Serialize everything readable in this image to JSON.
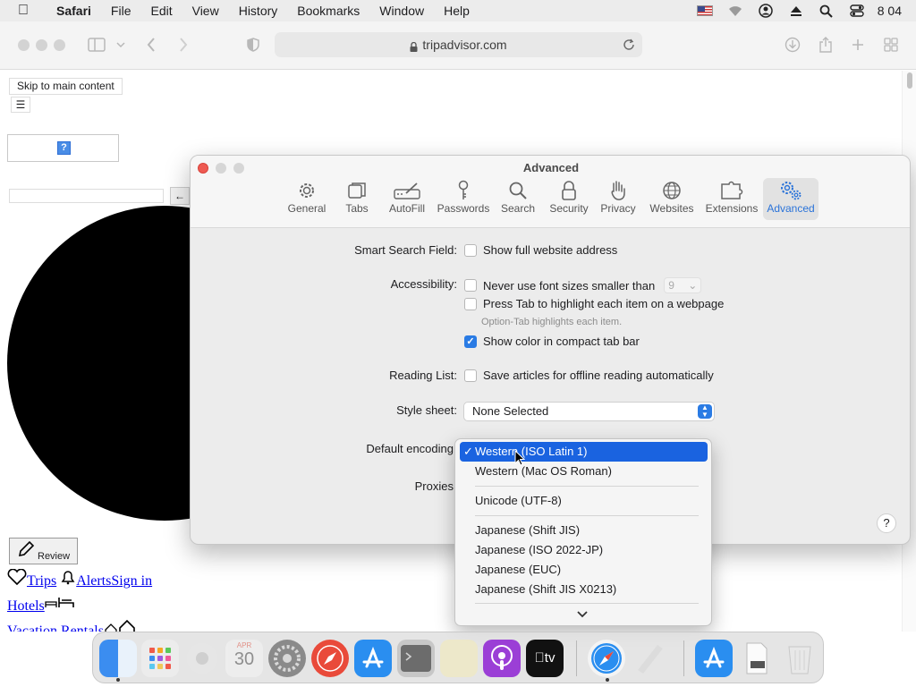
{
  "menubar": {
    "app": "Safari",
    "items": [
      "File",
      "Edit",
      "View",
      "History",
      "Bookmarks",
      "Window",
      "Help"
    ],
    "clock": "8 04"
  },
  "browser": {
    "url": "tripadvisor.com"
  },
  "page": {
    "skip_link": "Skip to main content",
    "review_label": "Review",
    "trips": "Trips",
    "alerts_signin": "AlertsSign in",
    "hotels": "Hotels",
    "vacation": "Vacation Rentals"
  },
  "prefs": {
    "title": "Advanced",
    "tabs": [
      "General",
      "Tabs",
      "AutoFill",
      "Passwords",
      "Search",
      "Security",
      "Privacy",
      "Websites",
      "Extensions",
      "Advanced"
    ],
    "active_tab": "Advanced",
    "accent": "#2a73d9",
    "smart_search": {
      "label": "Smart Search Field:",
      "option": "Show full website address",
      "checked": false
    },
    "accessibility": {
      "label": "Accessibility:",
      "font_option": "Never use font sizes smaller than",
      "font_size": "9",
      "tab_option": "Press Tab to highlight each item on a webpage",
      "tab_hint": "Option-Tab highlights each item.",
      "color_option": "Show color in compact tab bar",
      "color_checked": true
    },
    "reading_list": {
      "label": "Reading List:",
      "option": "Save articles for offline reading automatically",
      "checked": false
    },
    "style_sheet": {
      "label": "Style sheet:",
      "value": "None Selected"
    },
    "default_encoding": {
      "label": "Default encoding"
    },
    "proxies": {
      "label": "Proxies"
    }
  },
  "encoding_menu": {
    "selected": "Western (ISO Latin 1)",
    "groups": [
      [
        "Western (ISO Latin 1)",
        "Western (Mac OS Roman)"
      ],
      [
        "Unicode (UTF-8)"
      ],
      [
        "Japanese (Shift JIS)",
        "Japanese (ISO 2022-JP)",
        "Japanese (EUC)",
        "Japanese (Shift JIS X0213)"
      ]
    ],
    "highlight_color": "#1a63e0"
  },
  "dock": {
    "items": [
      "Finder",
      "Launchpad",
      "Chrome",
      "Calendar",
      "System Preferences",
      "Safari Technology Preview",
      "App Store",
      "Terminal",
      "Notes",
      "Podcasts",
      "Apple TV",
      "Safari",
      "TextEdit",
      "App Store Downloads",
      "Preview",
      "Trash"
    ],
    "calendar_month": "APR",
    "calendar_day": "30"
  }
}
